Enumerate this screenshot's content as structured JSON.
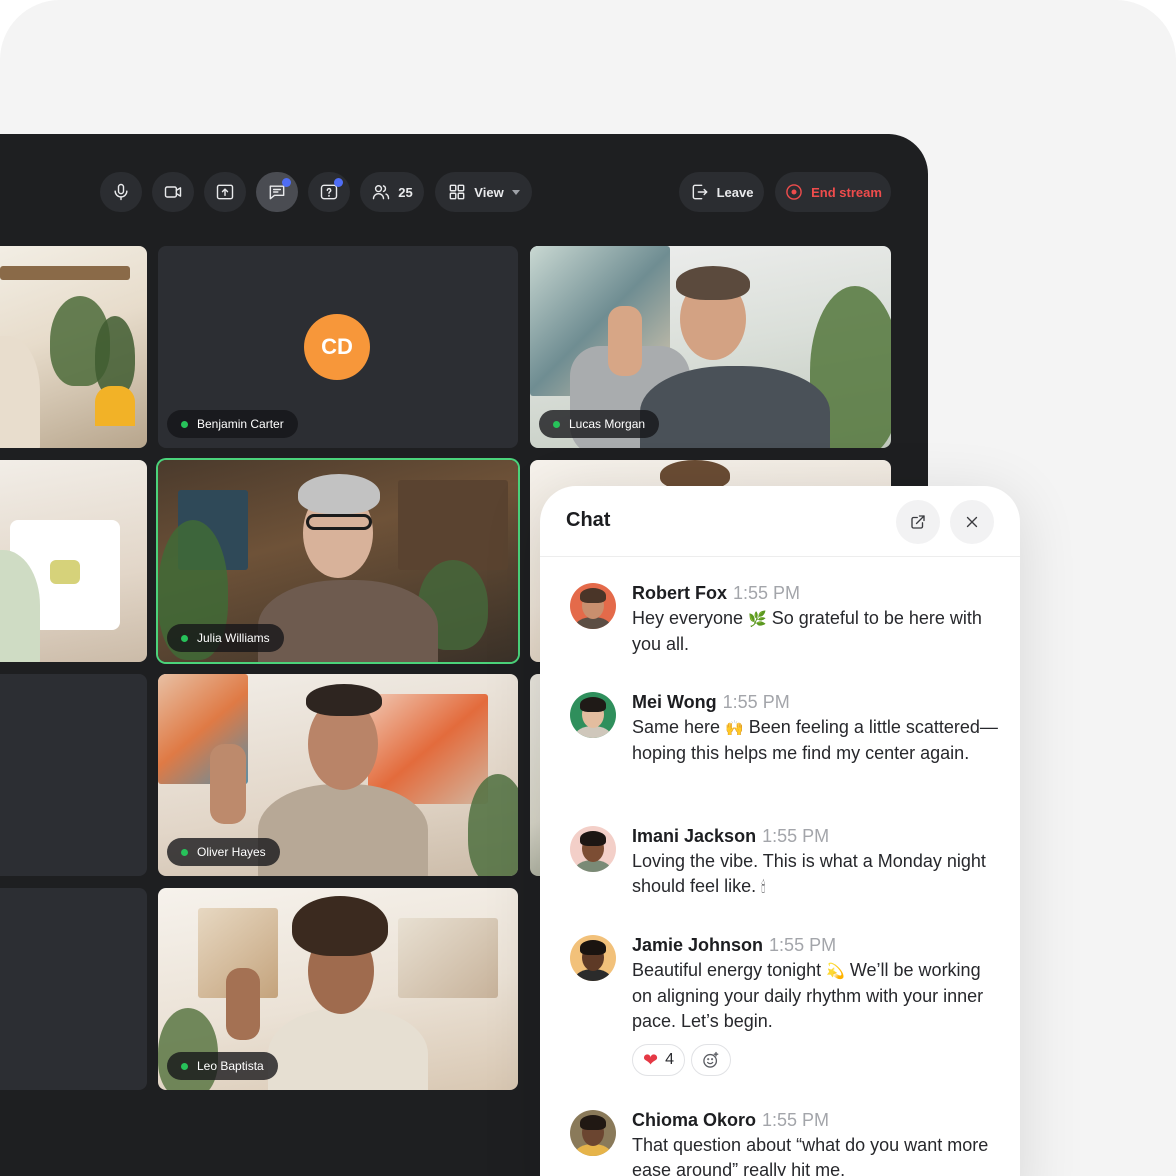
{
  "toolbar": {
    "participants_count": "25",
    "view_label": "View",
    "leave_label": "Leave",
    "end_stream_label": "End stream",
    "colors": {
      "accent_dot": "#4f6df5",
      "end_stream": "#ef4c4c"
    }
  },
  "participants": {
    "benjamin": {
      "name": "Benjamin Carter",
      "initials": "CD",
      "avatar_color": "#f7973a"
    },
    "lucas": {
      "name": "Lucas Morgan"
    },
    "julia": {
      "name": "Julia Williams"
    },
    "oliver": {
      "name": "Oliver Hayes"
    },
    "leo": {
      "name": "Leo Baptista"
    },
    "status_color": "#27c25a",
    "speaking_border": "#4bd37b"
  },
  "chat": {
    "title": "Chat",
    "messages": [
      {
        "name": "Robert Fox",
        "time": "1:55 PM",
        "text": "Hey everyone",
        "emoji": "🌿",
        "text2": "So grateful to be here with you all."
      },
      {
        "name": "Mei Wong",
        "time": "1:55 PM",
        "text": "Same here",
        "emoji": "🙌",
        "text2": "Been feeling a little scattered—hoping this helps me find my center again."
      },
      {
        "name": "Imani Jackson",
        "time": "1:55 PM",
        "text": "Loving the vibe. This is what a Monday night should feel like.",
        "emoji": "🕯"
      },
      {
        "name": "Jamie Johnson",
        "time": "1:55 PM",
        "text": "Beautiful energy tonight",
        "emoji": "💫",
        "text2": "We’ll be working on aligning your daily rhythm with your inner pace. Let’s begin.",
        "reaction_emoji": "❤",
        "reaction_count": "4"
      },
      {
        "name": "Chioma Okoro",
        "time": "1:55 PM",
        "text": "That question about “what do you want more ease around” really hit me."
      }
    ]
  }
}
